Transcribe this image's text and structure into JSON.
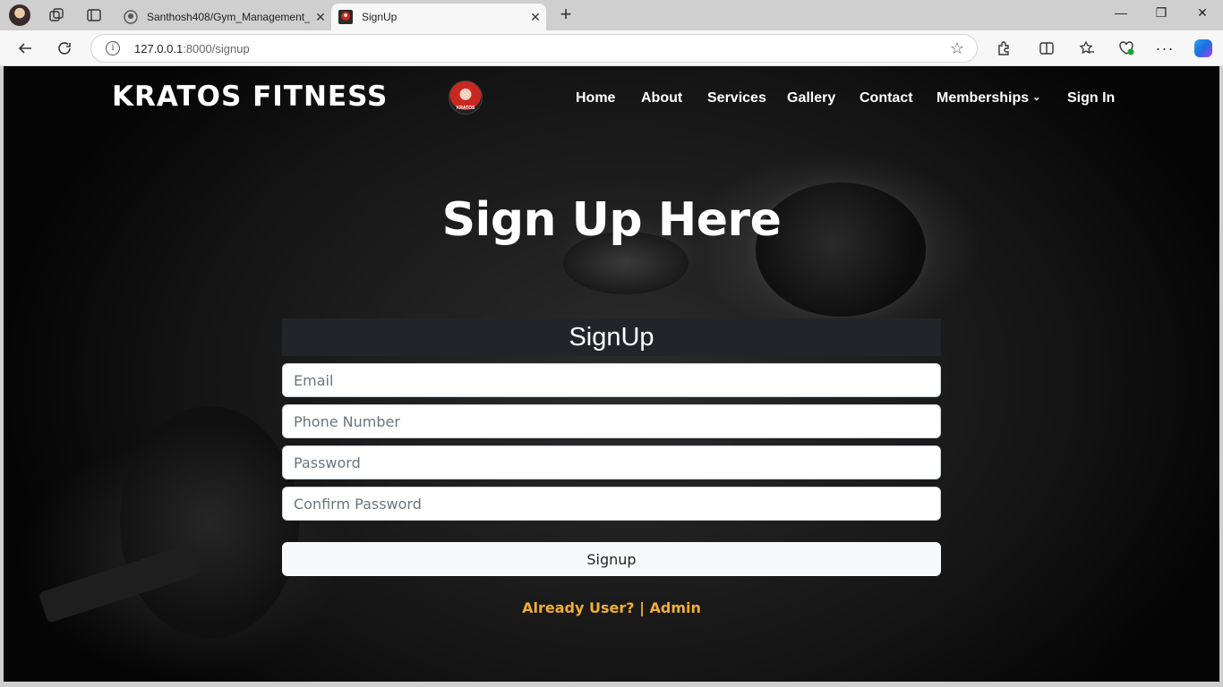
{
  "browser": {
    "tabs": [
      {
        "title": "Santhosh408/Gym_Management_",
        "close": "✕"
      },
      {
        "title": "SignUp",
        "close": "✕"
      }
    ],
    "new_tab": "+",
    "window": {
      "minimize": "—",
      "restore": "❐",
      "close": "✕"
    },
    "url_host": "127.0.0.1",
    "url_path": ":8000/signup",
    "icons": [
      "profile-icon",
      "workspaces-icon",
      "tab-actions-icon",
      "github-icon",
      "back-icon",
      "refresh-icon",
      "info-icon",
      "favorite-star-icon",
      "extensions-icon",
      "split-screen-icon",
      "favorites-icon",
      "browser-essentials-icon",
      "more-icon",
      "copilot-icon"
    ]
  },
  "site": {
    "brand": "KRATOS FITNESS",
    "logo_text": "KRATOS",
    "nav": [
      {
        "label": "Home"
      },
      {
        "label": "About"
      },
      {
        "label": "Services"
      },
      {
        "label": "Gallery"
      },
      {
        "label": "Contact"
      },
      {
        "label": "Memberships"
      },
      {
        "label": "Sign In"
      }
    ],
    "hero_title": "Sign Up Here",
    "form": {
      "header": "SignUp",
      "email_placeholder": "Email",
      "phone_placeholder": "Phone Number",
      "password_placeholder": "Password",
      "confirm_placeholder": "Confirm Password",
      "submit_label": "Signup"
    },
    "already_user": "Already User?",
    "separator": "|",
    "admin": "Admin",
    "accent_color": "#f0ad36"
  }
}
